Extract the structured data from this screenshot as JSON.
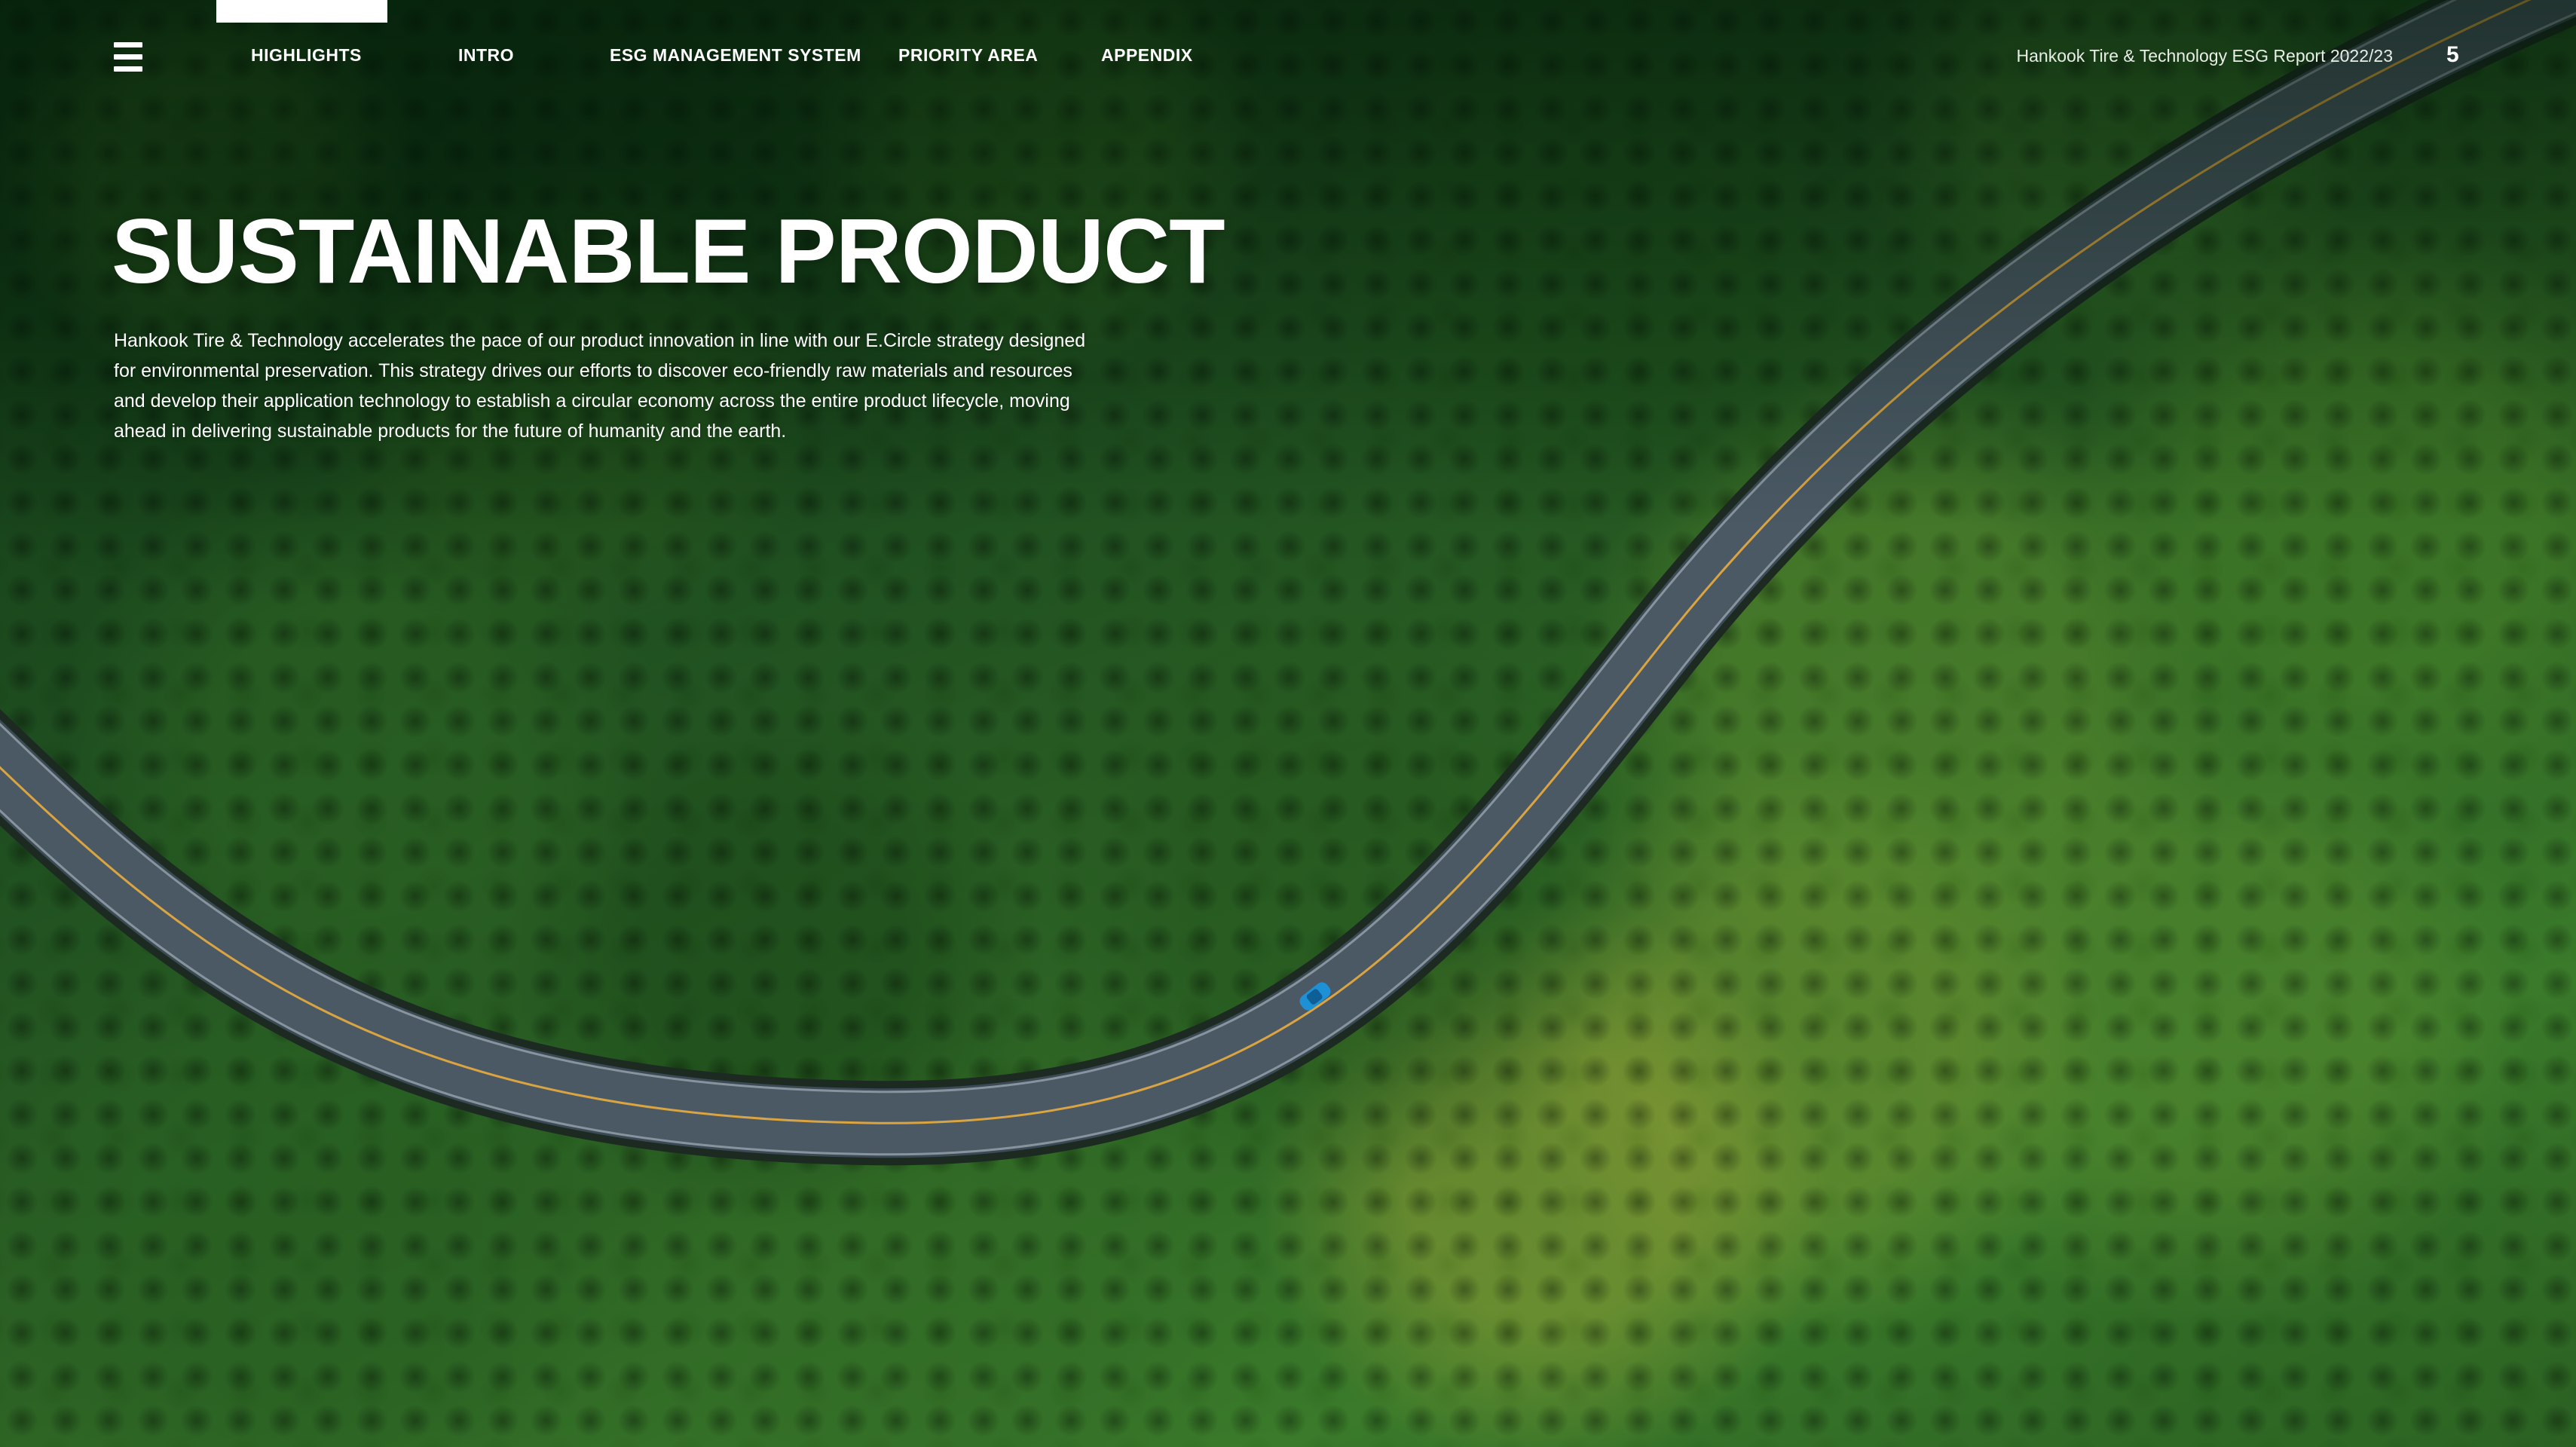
{
  "nav": {
    "menu_icon": "hamburger-menu-icon",
    "items": [
      {
        "label": "HIGHLIGHTS"
      },
      {
        "label": "INTRO"
      },
      {
        "label": "ESG MANAGEMENT SYSTEM"
      },
      {
        "label": "PRIORITY AREA"
      },
      {
        "label": "APPENDIX"
      }
    ],
    "report_title": "Hankook Tire & Technology ESG Report 2022/23",
    "page_number": "5"
  },
  "hero": {
    "title": "SUSTAINABLE PRODUCT",
    "description": "Hankook Tire & Technology accelerates the pace of our product innovation in line with our E.Circle strategy designed for environmental preservation. This strategy drives our efforts to discover eco-friendly raw materials and resources and develop their application technology to establish a circular economy across the entire product lifecycle, moving ahead in delivering sustainable products for the future of humanity and the earth."
  },
  "background": {
    "image": "aerial view of a winding road through dense green forest with a blue car",
    "colors": {
      "forest_dark": "#123a16",
      "forest_light": "#3a7a2a",
      "road": "#3b4a55",
      "road_center_line": "#d9a441",
      "car": "#1e90d6"
    }
  }
}
